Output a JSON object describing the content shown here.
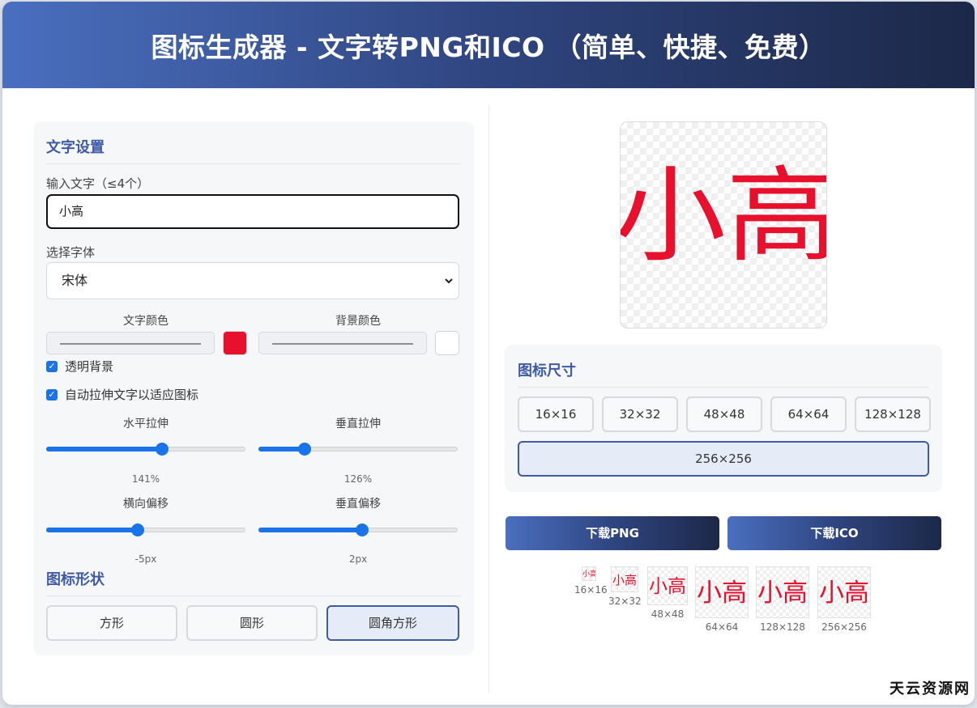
{
  "header": {
    "title": "图标生成器 - 文字转PNG和ICO （简单、快捷、免费）"
  },
  "text_settings": {
    "title": "文字设置",
    "input_label": "输入文字（≤4个）",
    "input_value": "小高",
    "font_label": "选择字体",
    "font_value": "宋体",
    "text_color_label": "文字颜色",
    "text_color": "#e8112d",
    "bg_color_label": "背景颜色",
    "bg_color": "#ffffff",
    "transparent_bg_label": "透明背景",
    "auto_stretch_label": "自动拉伸文字以适应图标",
    "h_stretch_label": "水平拉伸",
    "h_stretch_value": "141%",
    "h_stretch_fraction": 0.58,
    "v_stretch_label": "垂直拉伸",
    "v_stretch_value": "126%",
    "v_stretch_fraction": 0.23,
    "h_offset_label": "横向偏移",
    "h_offset_value": "-5px",
    "h_offset_fraction": 0.46,
    "v_offset_label": "垂直偏移",
    "v_offset_value": "2px",
    "v_offset_fraction": 0.52
  },
  "shape": {
    "title": "图标形状",
    "options": [
      "方形",
      "圆形",
      "圆角方形"
    ],
    "selected": "圆角方形"
  },
  "preview": {
    "text": "小高"
  },
  "size": {
    "title": "图标尺寸",
    "options": [
      "16×16",
      "32×32",
      "48×48",
      "64×64",
      "128×128",
      "256×256"
    ],
    "selected": "256×256"
  },
  "download": {
    "png_label": "下载PNG",
    "ico_label": "下载ICO"
  },
  "thumbnails": [
    {
      "text": "小高",
      "caption": "16×16"
    },
    {
      "text": "小高",
      "caption": "32×32"
    },
    {
      "text": "小高",
      "caption": "48×48"
    },
    {
      "text": "小高",
      "caption": "64×64"
    },
    {
      "text": "小高",
      "caption": "128×128"
    },
    {
      "text": "小高",
      "caption": "256×256"
    }
  ],
  "watermark": "天云资源网"
}
